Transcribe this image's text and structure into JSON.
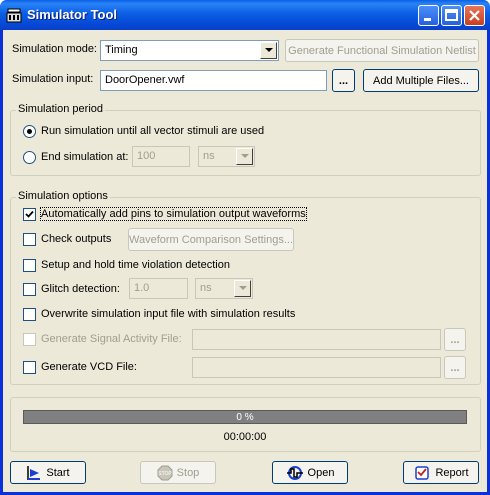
{
  "window": {
    "title": "Simulator Tool",
    "icon": "simulator-app-icon",
    "controls": [
      "minimize-icon",
      "maximize-icon",
      "close-icon"
    ]
  },
  "mode": {
    "label": "Simulation mode:",
    "value": "Timing",
    "netlist_button": "Generate Functional Simulation Netlist"
  },
  "input": {
    "label": "Simulation input:",
    "value": "DoorOpener.vwf",
    "browse_button": "...",
    "add_multiple_button": "Add Multiple Files..."
  },
  "period": {
    "title": "Simulation period",
    "run_all_label": "Run simulation until all vector stimuli are used",
    "end_at_label": "End simulation at:",
    "end_value": "100",
    "end_unit": "ns",
    "selected": "run_all"
  },
  "options": {
    "title": "Simulation options",
    "auto_add_pins": {
      "label": "Automatically add pins to simulation output waveforms",
      "checked": true
    },
    "check_outputs": {
      "label": "Check outputs",
      "checked": false
    },
    "waveform_comparison_button": "Waveform Comparison Settings...",
    "setup_hold": {
      "label": "Setup and hold time violation detection",
      "checked": false
    },
    "glitch": {
      "label": "Glitch detection:",
      "checked": false,
      "value": "1.0",
      "unit": "ns"
    },
    "overwrite": {
      "label": "Overwrite simulation input file with simulation results",
      "checked": false
    },
    "signal_activity": {
      "label": "Generate Signal Activity File:",
      "checked": false,
      "value": "",
      "browse": "..."
    },
    "vcd": {
      "label": "Generate VCD File:",
      "checked": false,
      "value": "",
      "browse": "..."
    }
  },
  "status": {
    "progress_text": "0 %",
    "progress_fraction": 0,
    "elapsed": "00:00:00"
  },
  "footer": {
    "start": "Start",
    "stop": "Stop",
    "open": "Open",
    "report": "Report",
    "stop_icon_text": "STOP"
  },
  "colors": {
    "titlebar": "#0a5fe7",
    "dialog_bg": "#ece9d8",
    "disabled_text": "#a09e90"
  }
}
